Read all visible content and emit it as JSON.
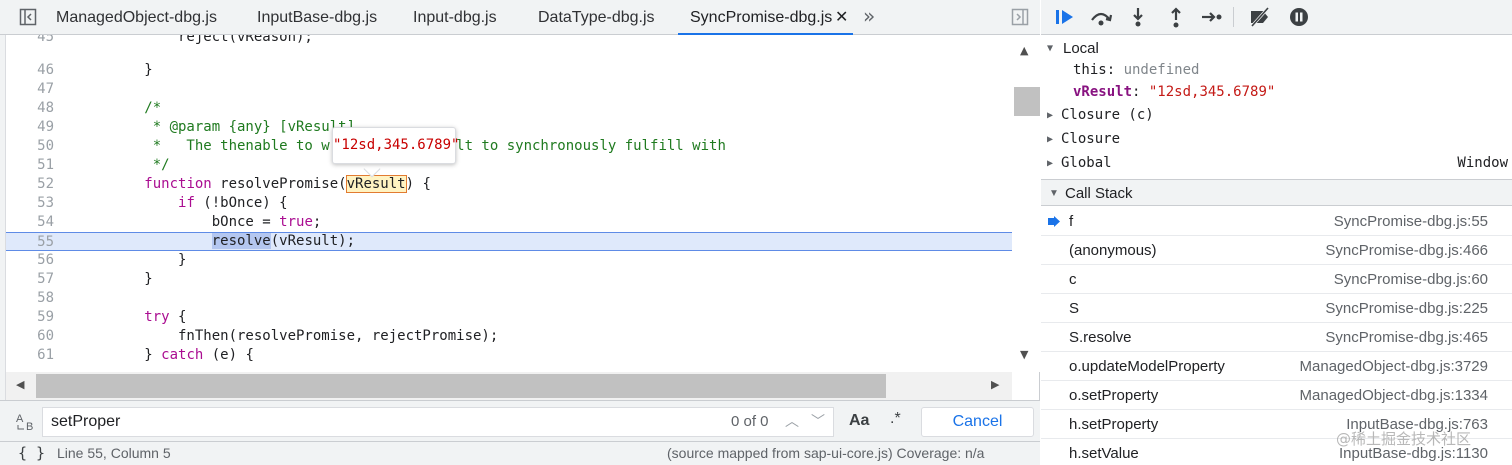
{
  "tabs": [
    {
      "label": "ManagedObject-dbg.js",
      "active": false
    },
    {
      "label": "InputBase-dbg.js",
      "active": false
    },
    {
      "label": "Input-dbg.js",
      "active": false
    },
    {
      "label": "DataType-dbg.js",
      "active": false
    },
    {
      "label": "SyncPromise-dbg.js",
      "active": true
    }
  ],
  "tab_close_glyph": "✕",
  "tab_overflow_glyph": "»",
  "code": {
    "lines": [
      {
        "n": "45",
        "text": "              reject(vReason);"
      },
      {
        "n": "46",
        "text": "          }"
      },
      {
        "n": "47",
        "text": ""
      },
      {
        "n": "48",
        "text": "          /*"
      },
      {
        "n": "49",
        "text": "           * @param {any} [vResult]"
      },
      {
        "n": "50",
        "text": "           *   The thenable to wrap or the result to synchronously fulfill with"
      },
      {
        "n": "51",
        "text": "           */"
      },
      {
        "n": "52",
        "pre": "          ",
        "kw": "function",
        "text": " resolvePromise(",
        "hover": "vResult",
        "post": ") {"
      },
      {
        "n": "53",
        "pre": "              ",
        "kw": "if",
        "text": " (!bOnce) {"
      },
      {
        "n": "54",
        "text": "                  bOnce = ",
        "kw2": "true",
        "post": ";"
      },
      {
        "n": "55",
        "pre": "                  ",
        "sel": "resolve",
        "text": "(vResult);"
      },
      {
        "n": "56",
        "text": "              }"
      },
      {
        "n": "57",
        "text": "          }"
      },
      {
        "n": "58",
        "text": ""
      },
      {
        "n": "59",
        "pre": "          ",
        "kw": "try",
        "text": " {"
      },
      {
        "n": "60",
        "text": "              fnThen(resolvePromise, rejectPromise);"
      },
      {
        "n": "61",
        "pre": "          } ",
        "kw": "catch",
        "text": " (e) {"
      }
    ],
    "current_line": "55",
    "tooltip_value": "\"12sd,345.6789\""
  },
  "search": {
    "value": "setProper",
    "match_count": "0 of 0",
    "match_case_label": "Aa",
    "regex_label": ".*",
    "cancel_label": "Cancel"
  },
  "status": {
    "position": "Line 55, Column 5",
    "source_map": "(source mapped from sap-ui-core.js) Coverage: n/a",
    "format_glyph": "{ }"
  },
  "scope": {
    "local_label": "Local",
    "this_name": "this",
    "this_value": "undefined",
    "var_name": "vResult",
    "var_value": "\"12sd,345.6789\"",
    "closure_c": "Closure (c)",
    "closure": "Closure",
    "global": "Global",
    "global_value": "Window"
  },
  "callstack": {
    "label": "Call Stack",
    "frames": [
      {
        "name": "f",
        "loc": "SyncPromise-dbg.js:55",
        "current": true
      },
      {
        "name": "(anonymous)",
        "loc": "SyncPromise-dbg.js:466"
      },
      {
        "name": "c",
        "loc": "SyncPromise-dbg.js:60"
      },
      {
        "name": "S",
        "loc": "SyncPromise-dbg.js:225"
      },
      {
        "name": "S.resolve",
        "loc": "SyncPromise-dbg.js:465"
      },
      {
        "name": "o.updateModelProperty",
        "loc": "ManagedObject-dbg.js:3729"
      },
      {
        "name": "o.setProperty",
        "loc": "ManagedObject-dbg.js:1334"
      },
      {
        "name": "h.setProperty",
        "loc": "InputBase-dbg.js:763"
      },
      {
        "name": "h.setValue",
        "loc": "InputBase-dbg.js:1130"
      }
    ]
  },
  "watermark": "@稀土掘金技术社区",
  "colors": {
    "accent": "#1a73e8",
    "keyword": "#aa0d91",
    "comment": "#1f7a1f",
    "string": "#c41a16"
  }
}
